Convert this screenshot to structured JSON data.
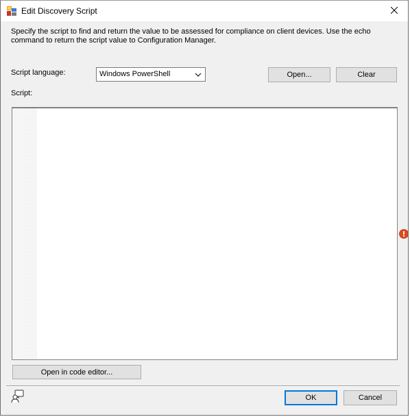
{
  "window": {
    "title": "Edit Discovery Script",
    "icon": "app-icon",
    "close_glyph": "✕"
  },
  "description": "Specify the script to find and return the value to be assessed for compliance on client devices. Use the echo command to return the script value to Configuration Manager.",
  "script_language": {
    "label": "Script language:",
    "selected": "Windows PowerShell",
    "chevron_icon": "chevron-down-icon"
  },
  "buttons": {
    "open": "Open...",
    "clear": "Clear",
    "open_code_editor": "Open in code editor...",
    "ok": "OK",
    "cancel": "Cancel"
  },
  "script": {
    "label": "Script:",
    "value": ""
  },
  "indicators": {
    "error_icon": "error-icon",
    "help_icon": "help-icon"
  },
  "colors": {
    "accent": "#0078d7",
    "error": "#e04a1f",
    "dialog_bg": "#f0f0f0",
    "button_bg": "#e1e1e1"
  }
}
